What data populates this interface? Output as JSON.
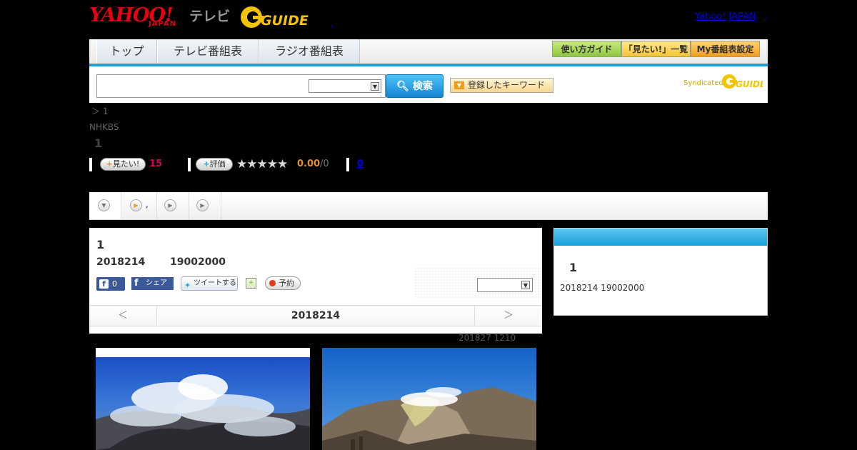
{
  "header": {
    "brand_yahoo": "YAHOO!",
    "brand_japan": "JAPAN",
    "brand_tv": "テレビ",
    "brand_gguide": "GUIDE",
    "top_link": "Yahoo! JAPAN",
    "top_link_sep": ",",
    "blue_dot": ","
  },
  "nav": {
    "tabs": [
      "トップ",
      "テレビ番組表",
      "ラジオ番組表"
    ],
    "buttons": [
      "使い方ガイド",
      "「見たい!」一覧",
      "My番組表設定"
    ]
  },
  "search": {
    "placeholder": "",
    "button_label": "検索",
    "keyword_button": "登録したキーワード",
    "syndicated": "Syndicated",
    "syndicated_logo": "GUIDE"
  },
  "breadcrumb": "＞ 1",
  "station": "NHKBS",
  "big_title": "1",
  "stats": {
    "want_label": "見たい!",
    "want_count": "15",
    "rate_label": "評価",
    "stars": "★★★★★",
    "rating": "0.00",
    "rating_den": "/0",
    "review_count": "0"
  },
  "program": {
    "title": "1",
    "date": "2018214",
    "time": "19002000",
    "fb_like_count": "0",
    "fb_share": "シェア",
    "tweet": "ツイートする",
    "reserve": "予約",
    "pager_prev": "＜",
    "pager_date": "2018214",
    "pager_next": "＞",
    "updated": "201827  1210"
  },
  "side": {
    "title": "1",
    "date": "2018214  19002000"
  },
  "icons": {
    "search": "search-icon",
    "dropdown": "chevron-down-icon"
  },
  "colors": {
    "accent_blue": "#1ea0dc",
    "want_red": "#d6005c",
    "rating_orange": "#e0922a",
    "link": "#0000de"
  }
}
